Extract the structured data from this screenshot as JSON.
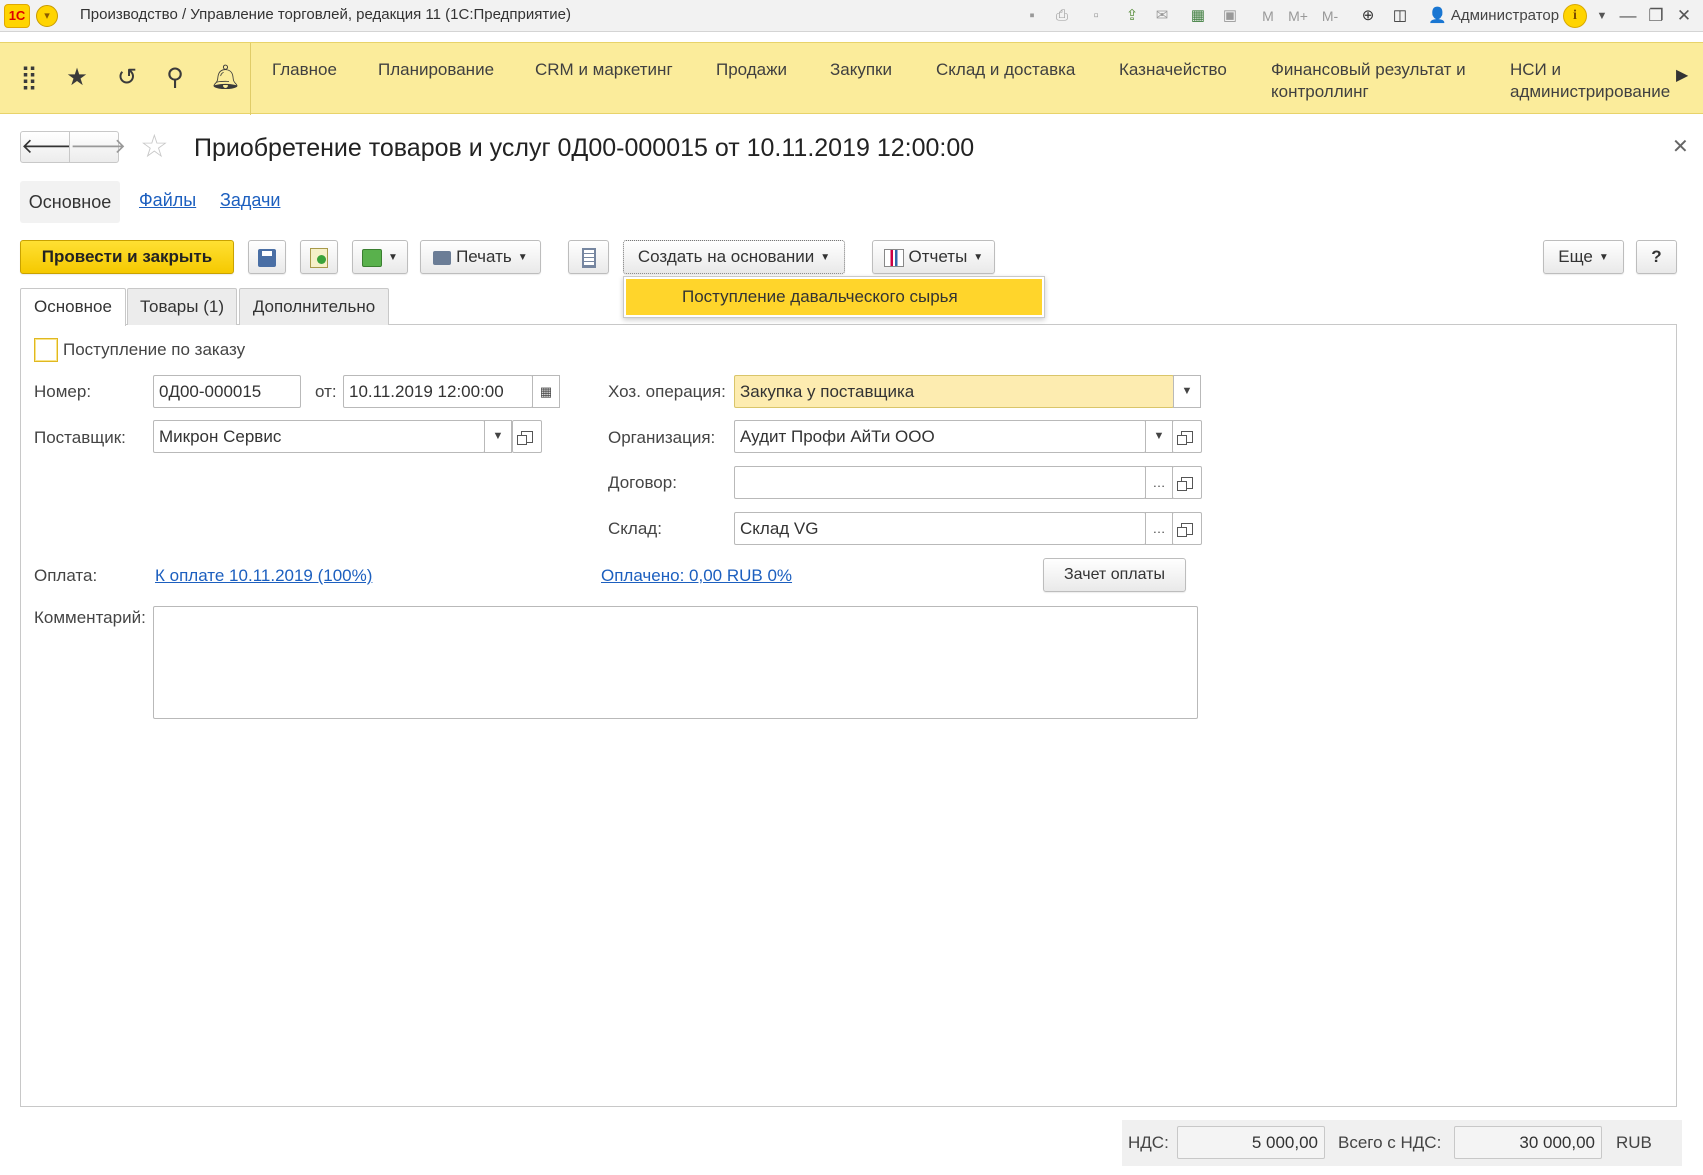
{
  "window": {
    "title": "Производство / Управление торговлей, редакция 11  (1С:Предприятие)",
    "logo": "1С",
    "user": "Администратор",
    "memory_buttons": [
      "M",
      "M+",
      "M-"
    ]
  },
  "sections": [
    {
      "label": "Главное"
    },
    {
      "label": "Планирование"
    },
    {
      "label": "CRM и маркетинг"
    },
    {
      "label": "Продажи"
    },
    {
      "label": "Закупки"
    },
    {
      "label": "Склад и доставка"
    },
    {
      "label": "Казначейство"
    },
    {
      "label": "Финансовый результат и\nконтроллинг"
    },
    {
      "label": "НСИ и\nадминистрирование"
    }
  ],
  "form": {
    "title": "Приобретение товаров и услуг 0Д00-000015 от 10.11.2019 12:00:00",
    "nav_tabs": {
      "main": "Основное",
      "files": "Файлы",
      "tasks": "Задачи"
    }
  },
  "commands": {
    "post_close": "Провести и закрыть",
    "print": "Печать",
    "create_based": "Создать на основании",
    "reports": "Отчеты",
    "more": "Еще",
    "help": "?"
  },
  "dropdown": {
    "items": [
      "Поступление давальческого сырья"
    ]
  },
  "page_tabs": [
    "Основное",
    "Товары (1)",
    "Дополнительно"
  ],
  "fields": {
    "by_order_label": "Поступление по заказу",
    "number_label": "Номер:",
    "number": "0Д00-000015",
    "from_label": "от:",
    "date": "10.11.2019 12:00:00",
    "supplier_label": "Поставщик:",
    "supplier": "Микрон Сервис",
    "operation_label": "Хоз. операция:",
    "operation": "Закупка у поставщика",
    "org_label": "Организация:",
    "org": "Аудит Профи АйТи ООО",
    "contract_label": "Договор:",
    "contract": "",
    "warehouse_label": "Склад:",
    "warehouse": "Склад VG",
    "payment_label": "Оплата:",
    "payment_link": "К оплате 10.11.2019 (100%)",
    "paid_link": "Оплачено: 0,00 RUB  0%",
    "offset_button": "Зачет оплаты",
    "comment_label": "Комментарий:",
    "comment": ""
  },
  "totals": {
    "vat_label": "НДС:",
    "vat": "5 000,00",
    "total_label": "Всего с НДС:",
    "total": "30 000,00",
    "currency": "RUB"
  },
  "colors": {
    "accent_yellow": "#ffd52b",
    "section_bar": "#fbec9b",
    "link": "#1c5fbf"
  }
}
